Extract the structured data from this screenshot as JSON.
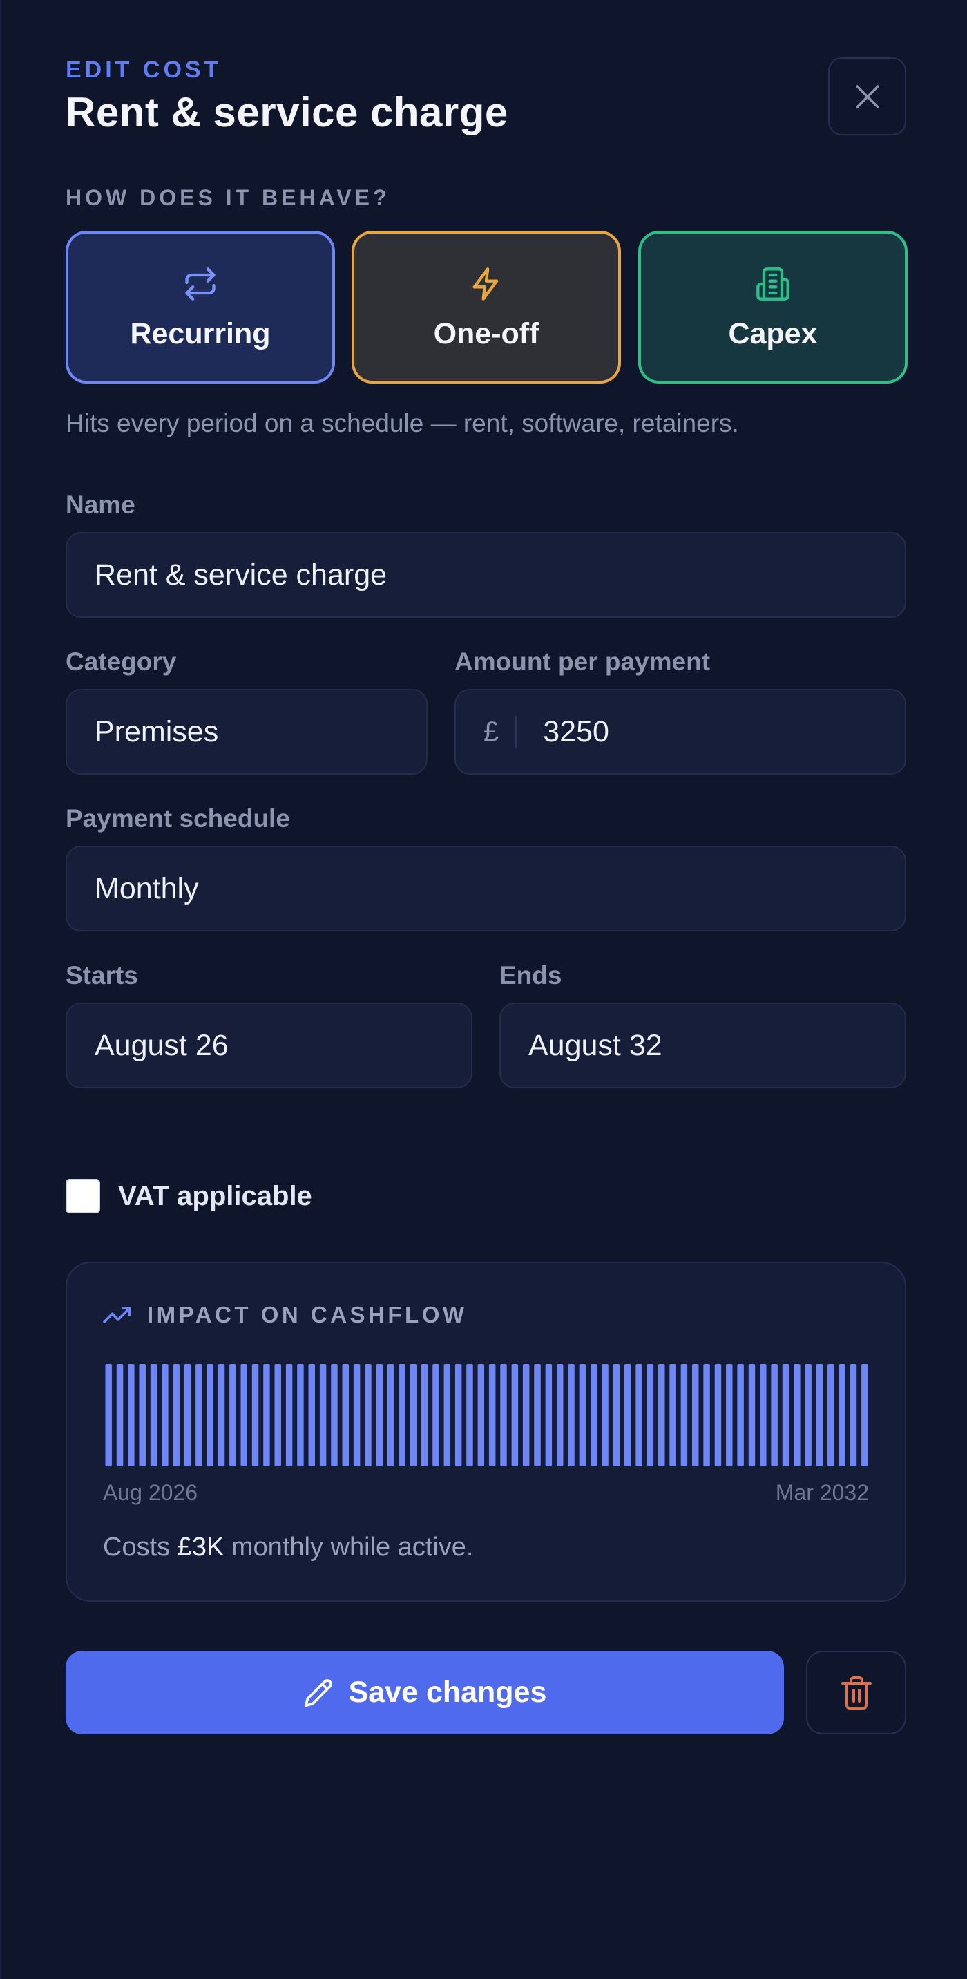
{
  "header": {
    "eyebrow": "EDIT COST",
    "title": "Rent & service charge"
  },
  "behaviour": {
    "label": "HOW DOES IT BEHAVE?",
    "options": [
      {
        "label": "Recurring",
        "icon": "repeat-icon",
        "color": "#6f87f5",
        "selected": true
      },
      {
        "label": "One-off",
        "icon": "lightning-icon",
        "color": "#e9a63c",
        "selected": false
      },
      {
        "label": "Capex",
        "icon": "building-icon",
        "color": "#2fbf86",
        "selected": false
      }
    ],
    "helper": "Hits every period on a schedule — rent, software, retainers."
  },
  "form": {
    "name": {
      "label": "Name",
      "value": "Rent & service charge"
    },
    "category": {
      "label": "Category",
      "value": "Premises"
    },
    "amount": {
      "label": "Amount per payment",
      "currency": "£",
      "value": "3250"
    },
    "schedule": {
      "label": "Payment schedule",
      "value": "Monthly"
    },
    "starts": {
      "label": "Starts",
      "value": "August 26"
    },
    "ends": {
      "label": "Ends",
      "value": "August 32"
    },
    "vat": {
      "label": "VAT applicable",
      "checked": false
    }
  },
  "impact": {
    "title": "IMPACT ON CASHFLOW",
    "start_label": "Aug 2026",
    "end_label": "Mar 2032",
    "note_prefix": "Costs",
    "note_amount": "£3K",
    "note_suffix": "monthly while active.",
    "bar_color": "#6f87f5",
    "bar_count": 68
  },
  "actions": {
    "save_label": "Save changes",
    "primary_color": "#4f6aec",
    "delete_color": "#e0704a"
  }
}
